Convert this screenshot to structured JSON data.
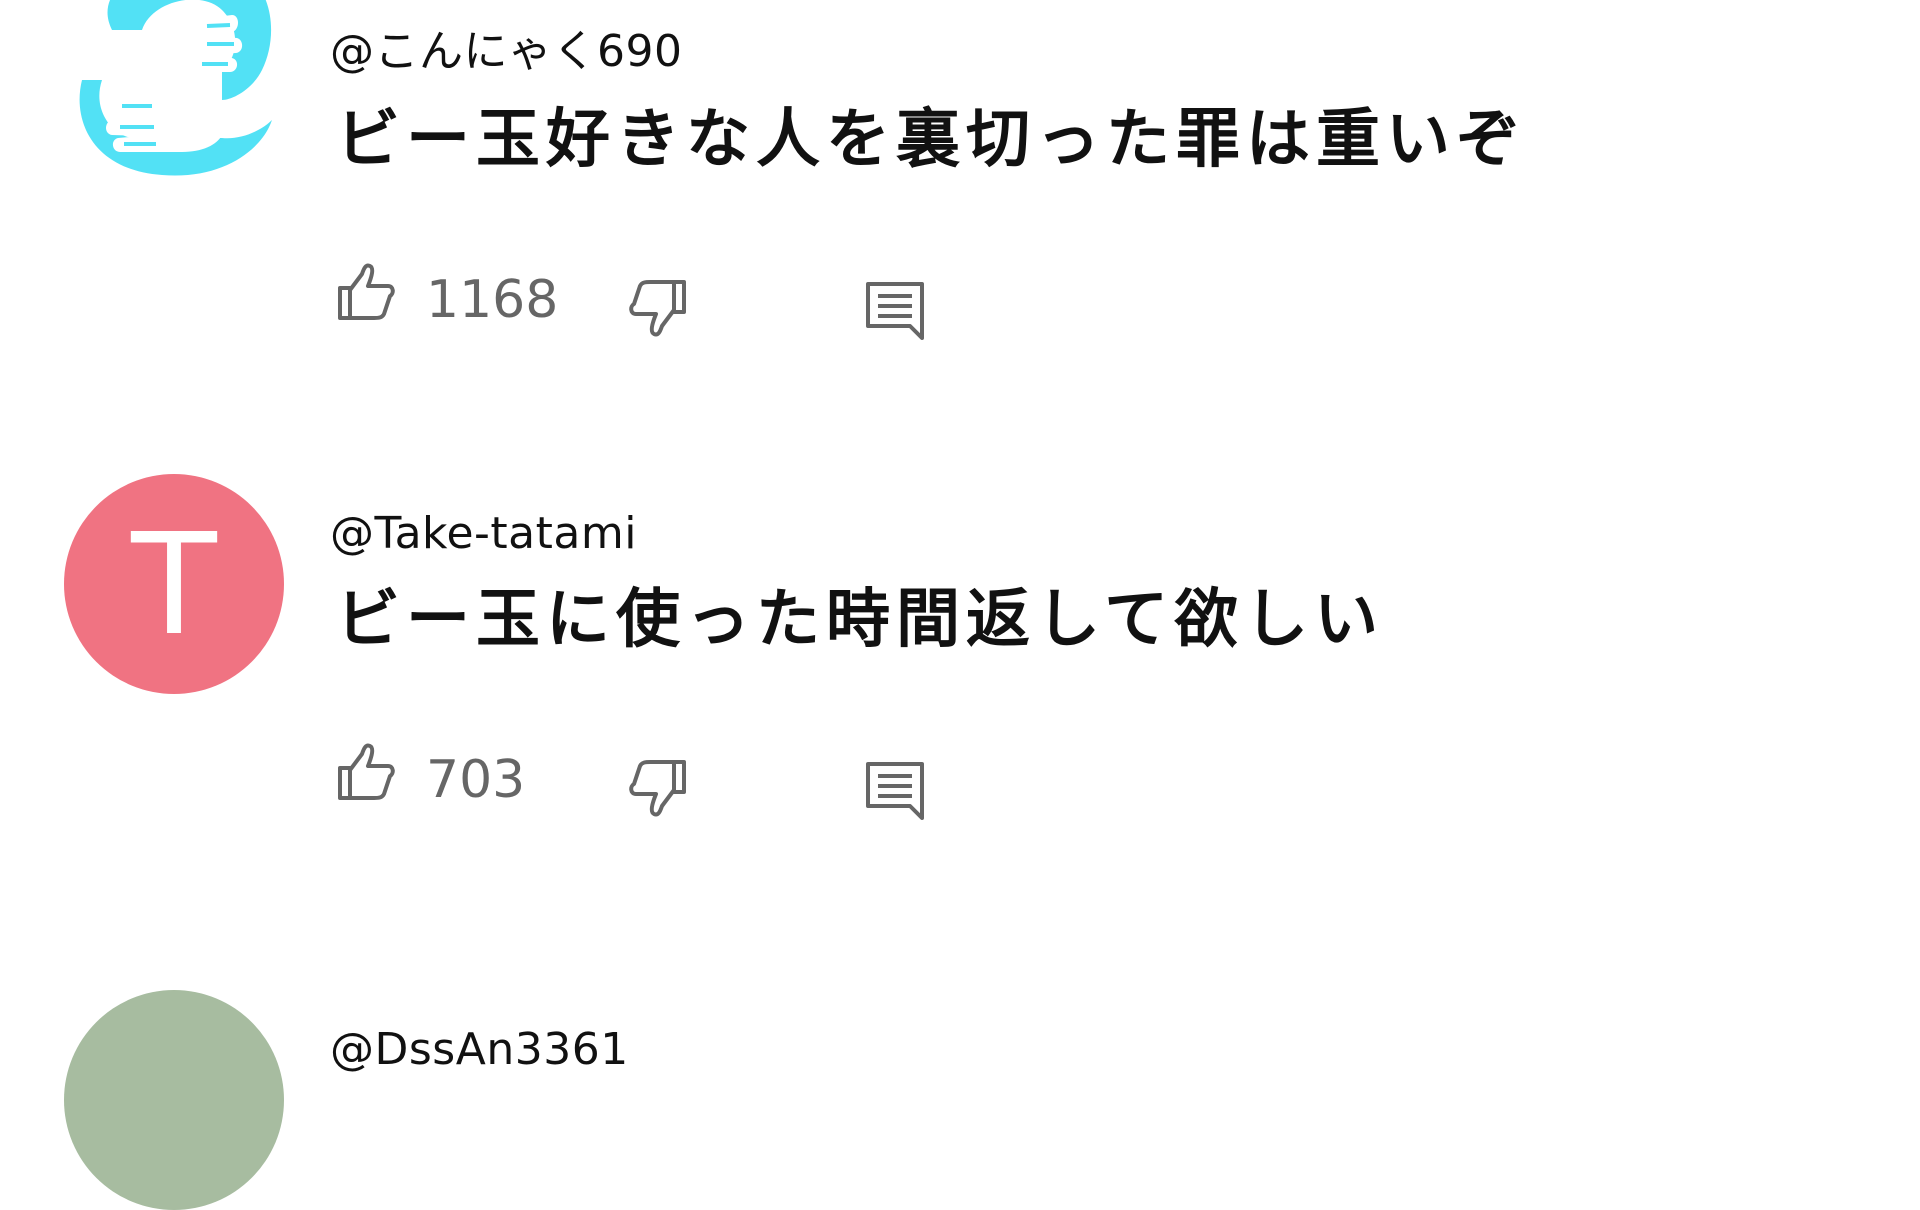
{
  "comments": [
    {
      "handle": "@こんにゃく690",
      "text": "ビー玉好きな人を裏切った罪は重いぞ",
      "likes": "1168",
      "avatar": {
        "type": "image",
        "icon": "hands-logo-icon",
        "color": "#52e1f5"
      }
    },
    {
      "handle": "@Take-tatami",
      "text": "ビー玉に使った時間返して欲しい",
      "likes": "703",
      "avatar": {
        "type": "letter",
        "letter": "T",
        "color": "#f07382"
      }
    },
    {
      "handle": "@DssAn3361",
      "text": "",
      "likes": "",
      "avatar": {
        "type": "color",
        "color": "#a7bca0"
      }
    }
  ],
  "icons": {
    "like": "thumbs-up-icon",
    "dislike": "thumbs-down-icon",
    "reply": "comment-reply-icon"
  },
  "colors": {
    "icon_gray": "#666666",
    "text": "#111111"
  }
}
